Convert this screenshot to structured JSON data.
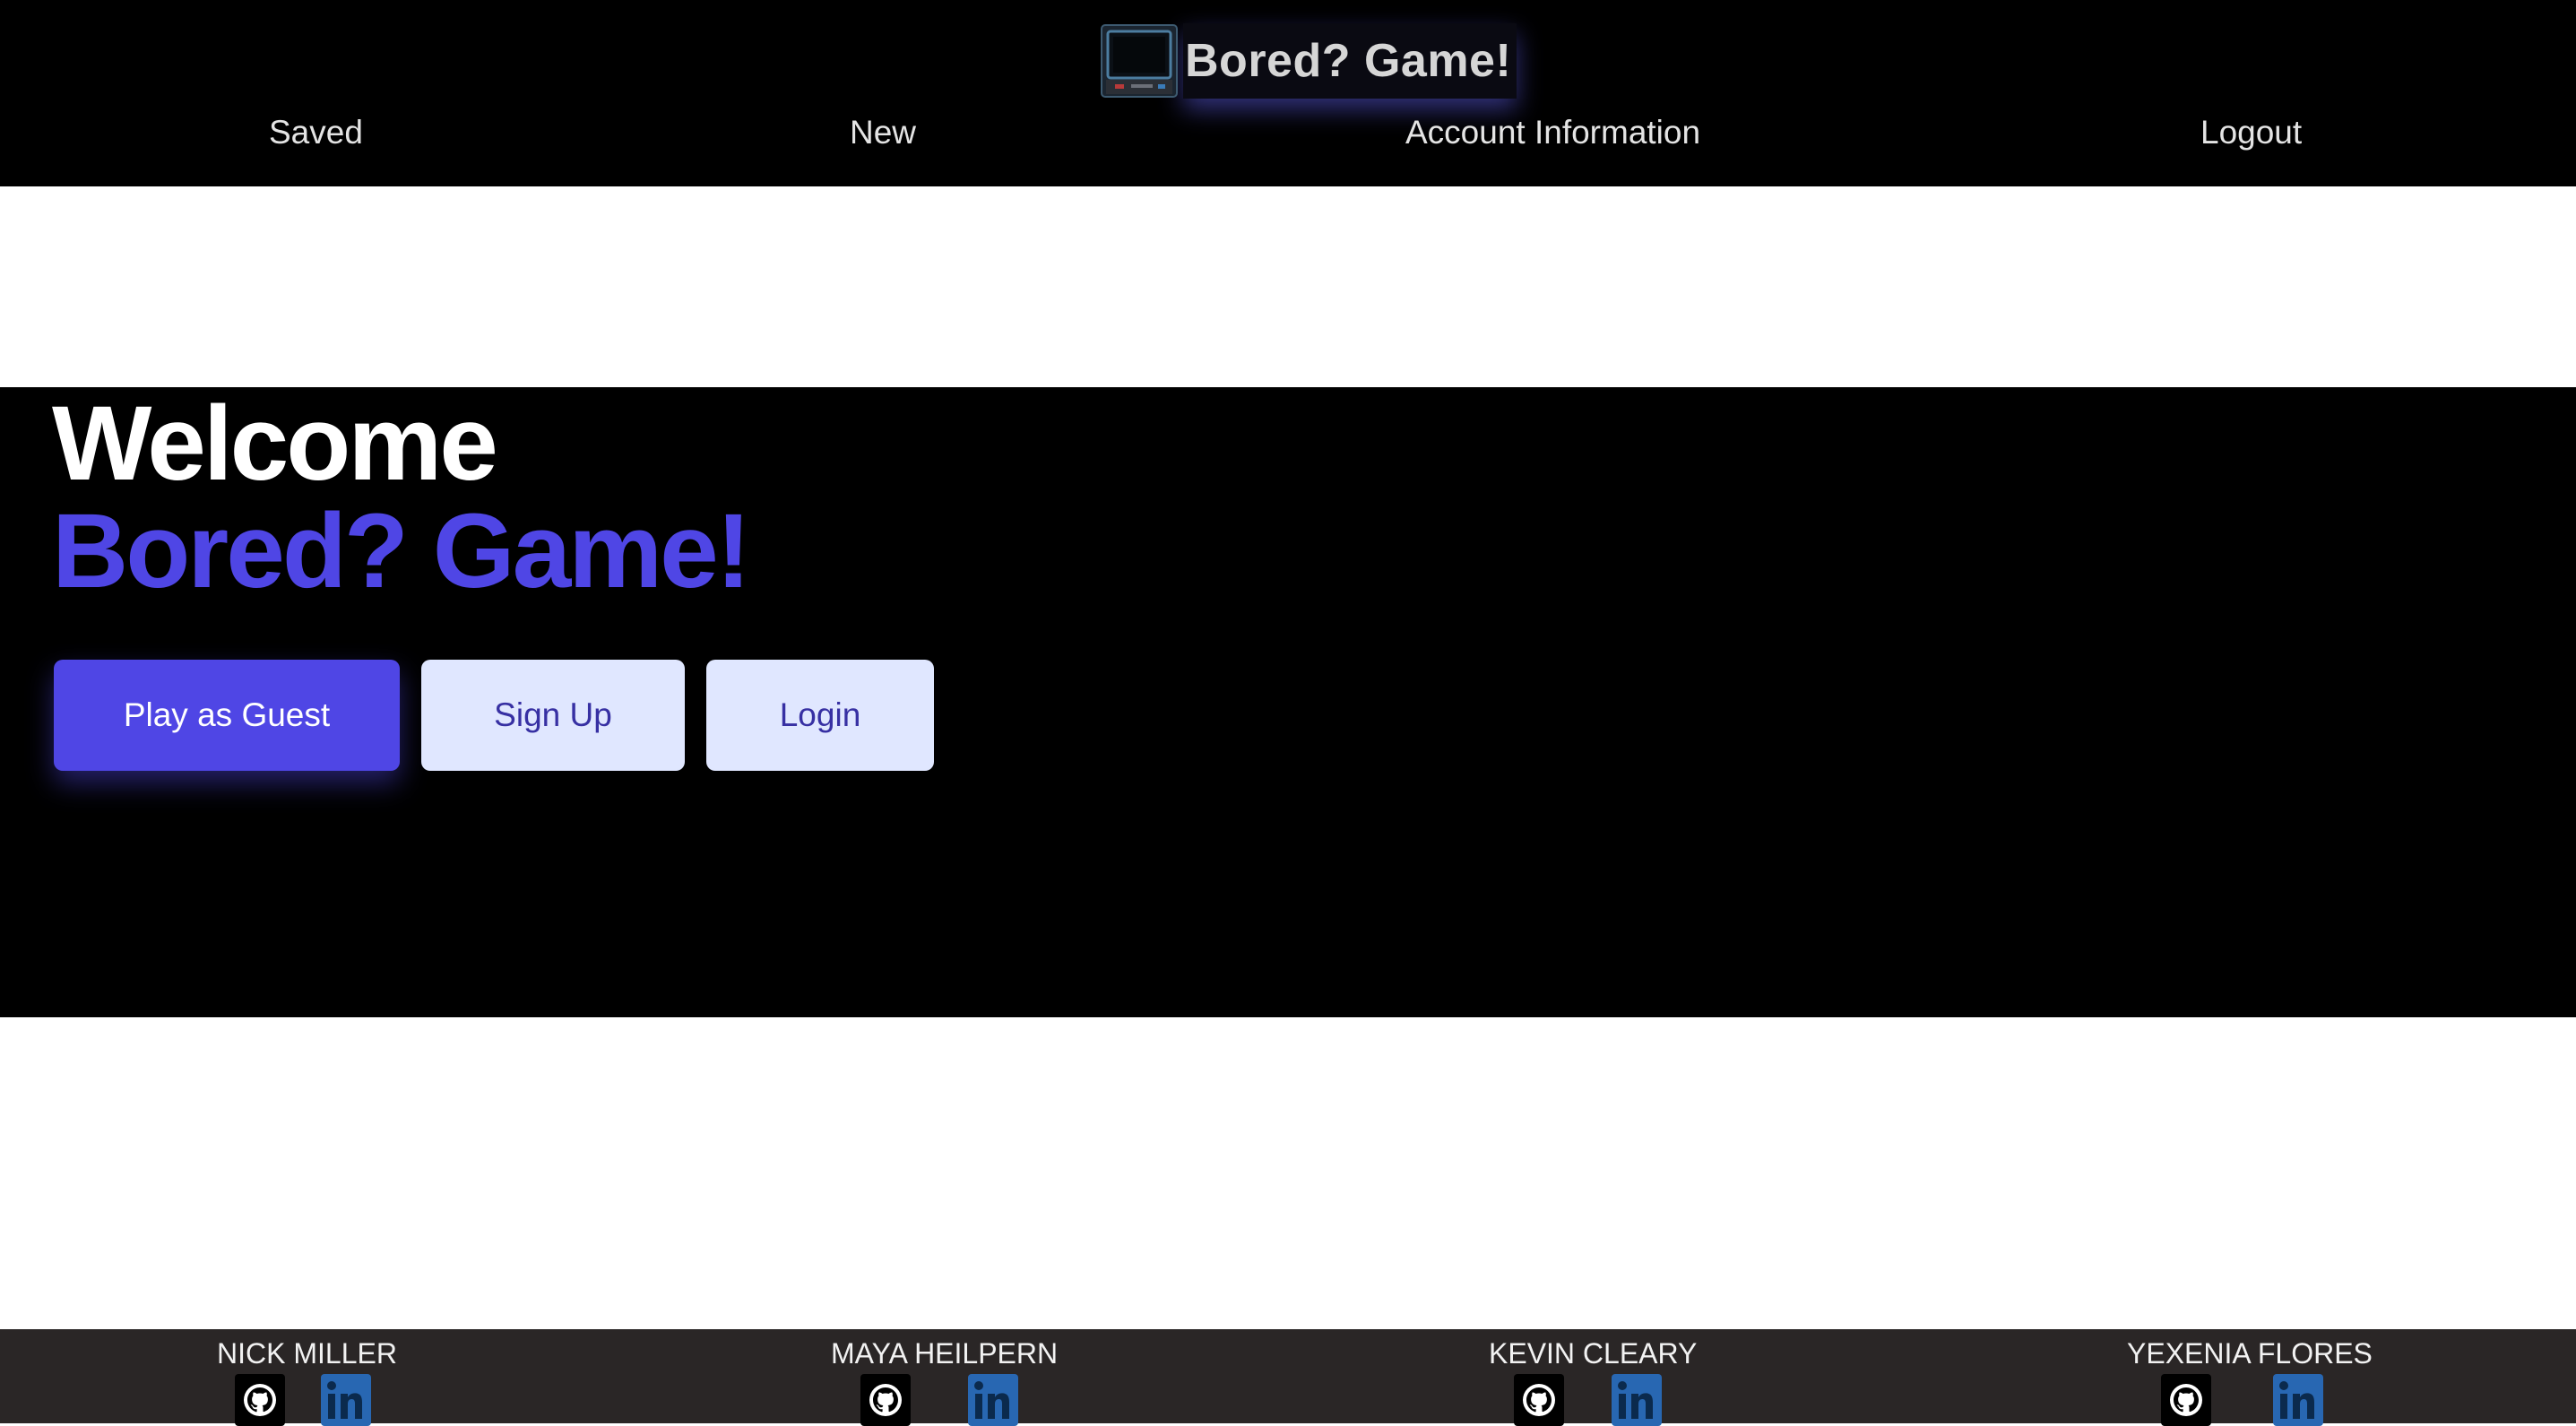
{
  "header": {
    "brand_title": "Bored? Game!",
    "logo_icon": "arcade-machine-icon",
    "nav": {
      "saved": "Saved",
      "new": "New",
      "account": "Account Information",
      "logout": "Logout"
    }
  },
  "hero": {
    "welcome": "Welcome",
    "brand": "Bored? Game!",
    "buttons": {
      "guest": "Play as Guest",
      "signup": "Sign Up",
      "login": "Login"
    }
  },
  "footer": {
    "members": [
      {
        "name": "NICK MILLER",
        "github_icon": "github-icon",
        "linkedin_icon": "linkedin-icon"
      },
      {
        "name": "MAYA HEILPERN",
        "github_icon": "github-icon",
        "linkedin_icon": "linkedin-icon"
      },
      {
        "name": "KEVIN CLEARY",
        "github_icon": "github-icon",
        "linkedin_icon": "linkedin-icon"
      },
      {
        "name": "YEXENIA FLORES",
        "github_icon": "github-icon",
        "linkedin_icon": "linkedin-icon"
      }
    ]
  },
  "colors": {
    "accent": "#4f46e5",
    "secondary_button_bg": "#e0e7ff",
    "secondary_button_text": "#3730a3",
    "header_bg": "#000000",
    "footer_bg": "#2a2626",
    "linkedin_blue": "#2867b2"
  }
}
